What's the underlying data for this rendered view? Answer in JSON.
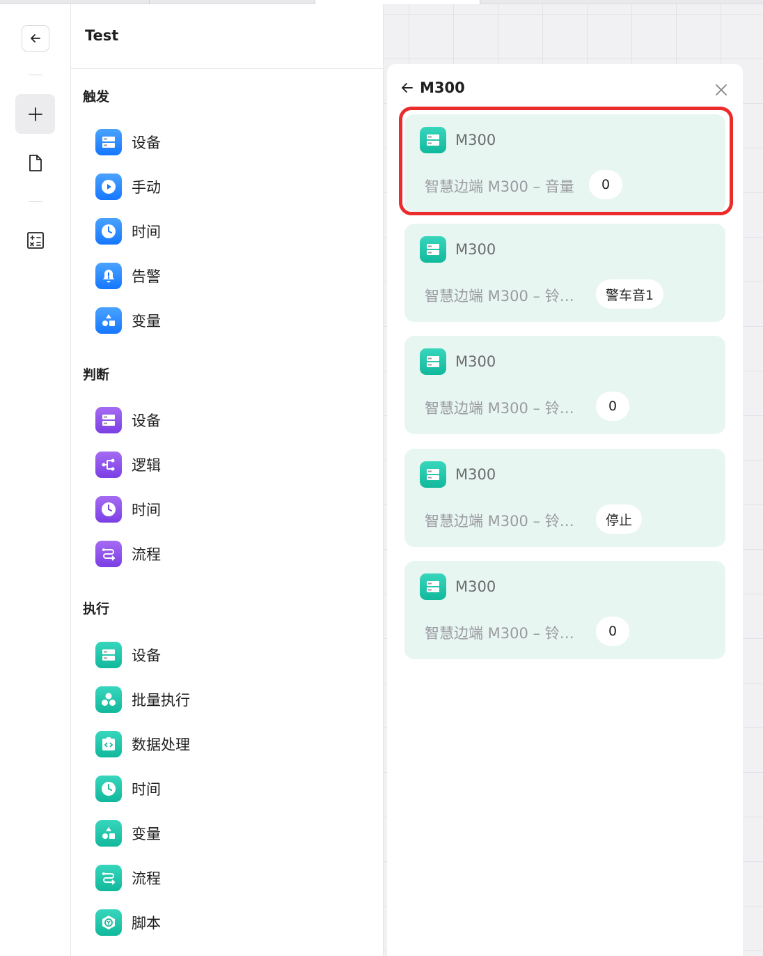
{
  "workflow": {
    "title": "Test"
  },
  "rail": {
    "back_icon": "arrow-left-icon",
    "add_icon": "plus-icon",
    "file_icon": "file-icon",
    "calc_icon": "calculator-icon"
  },
  "palette": {
    "sections": [
      {
        "heading": "触发",
        "items": [
          {
            "label": "设备",
            "icon": "device-icon",
            "color": "blue"
          },
          {
            "label": "手动",
            "icon": "play-icon",
            "color": "blue"
          },
          {
            "label": "时间",
            "icon": "clock-icon",
            "color": "blue"
          },
          {
            "label": "告警",
            "icon": "alarm-icon",
            "color": "blue"
          },
          {
            "label": "变量",
            "icon": "shapes-icon",
            "color": "blue"
          }
        ]
      },
      {
        "heading": "判断",
        "items": [
          {
            "label": "设备",
            "icon": "device-icon",
            "color": "purple"
          },
          {
            "label": "逻辑",
            "icon": "branch-icon",
            "color": "purple"
          },
          {
            "label": "时间",
            "icon": "clock-icon",
            "color": "purple"
          },
          {
            "label": "流程",
            "icon": "flow-icon",
            "color": "purple"
          }
        ]
      },
      {
        "heading": "执行",
        "items": [
          {
            "label": "设备",
            "icon": "device-icon",
            "color": "teal"
          },
          {
            "label": "批量执行",
            "icon": "batch-icon",
            "color": "teal"
          },
          {
            "label": "数据处理",
            "icon": "code-icon",
            "color": "teal"
          },
          {
            "label": "时间",
            "icon": "clock-icon",
            "color": "teal"
          },
          {
            "label": "变量",
            "icon": "shapes-icon",
            "color": "teal"
          },
          {
            "label": "流程",
            "icon": "flow-icon",
            "color": "teal"
          },
          {
            "label": "脚本",
            "icon": "script-icon",
            "color": "teal"
          }
        ]
      }
    ]
  },
  "detail": {
    "title": "M300",
    "back_icon": "arrow-left-icon",
    "close_icon": "close-icon",
    "cards": [
      {
        "name": "M300",
        "desc": "智慧边端 M300 – 音量",
        "value": "0",
        "highlighted": true
      },
      {
        "name": "M300",
        "desc": "智慧边端 M300 – 铃…",
        "value": "警车音1",
        "highlighted": false
      },
      {
        "name": "M300",
        "desc": "智慧边端 M300 – 铃…",
        "value": "0",
        "highlighted": false
      },
      {
        "name": "M300",
        "desc": "智慧边端 M300 – 铃…",
        "value": "停止",
        "highlighted": false
      },
      {
        "name": "M300",
        "desc": "智慧边端 M300 – 铃…",
        "value": "0",
        "highlighted": false
      }
    ]
  },
  "colors": {
    "highlight": "#ec2b2b",
    "card_bg": "#e8f6f1",
    "teal": "#12b89c",
    "blue": "#1677ff",
    "purple": "#7b3fe4"
  }
}
